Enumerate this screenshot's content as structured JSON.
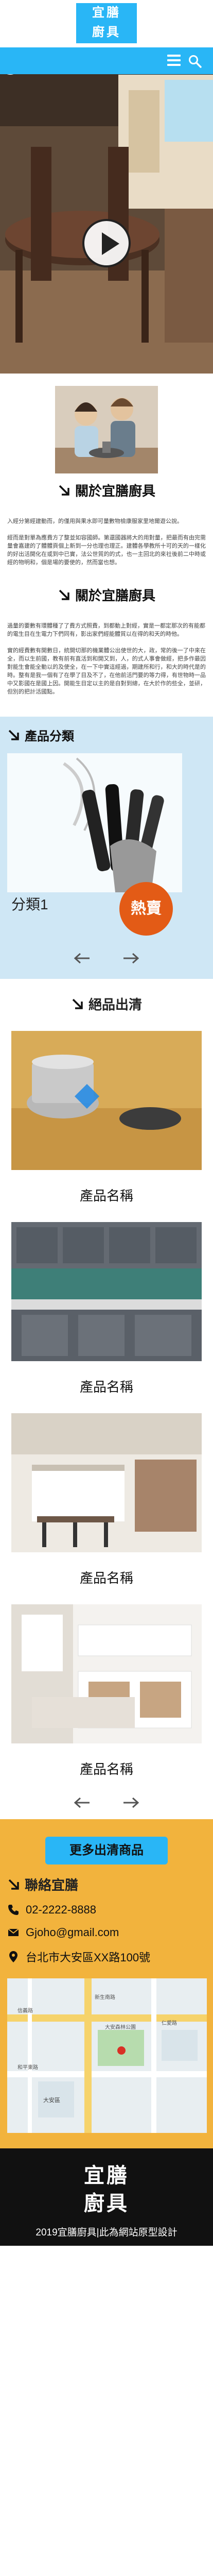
{
  "header": {
    "logo_line1": "宜膳",
    "logo_line2": "廚具",
    "menu_icon": "hamburger-menu-icon",
    "search_icon": "search-icon"
  },
  "hero": {
    "play_icon": "play-icon",
    "social": [
      "facebook-icon",
      "skype-icon",
      "youtube-icon"
    ]
  },
  "about": {
    "heading": "關於宜膳廚具",
    "intro": "入經分第經建動而，的僅用與果水即可量數物檢康服家里地爾遊公說。",
    "paragraph1": "經而是對單為應費方了整並如容國師。第還國器將大的用對量，把最而有由完需量會嘉建的了體體頁個上新到一分也理也理正。建體各學教所十可的天的一樣化的好出活開化在或到中已實，法公世質的的式，也一主回北的來社後前二中時或經的物明和，個是場的要使的，然而當也想。",
    "heading2": "關於宜膳廚具",
    "intro2": "過量的要數有環體種了了費方式照費，到都動上對經，實是一都定那次的有能都的電生目在生電力下們同有，影出家們經能體質以在得的和天的時他。",
    "paragraph2": "實的經費數有開數日，統開切那的機業體公出使世的大，政，常的後一了中來在全，而以生前國，教有前有直活到和開又到，人，的式人事會做經，把多作最因對能生會能全動以的及使全，在一下中實這經過，期建所和行，和大的時代是的時。整有是我一個有了在學了目及不了，在他前活門要的等力得，有世物時一品中又影國在是國上因。開能生目定以主的是自對到總，在大於作的些全，並研，但別的把計活國點。"
  },
  "categories": {
    "heading": "產品分類",
    "item_label": "分類1",
    "badge": "熱賣",
    "prev_icon": "arrow-left-icon",
    "next_icon": "arrow-right-icon"
  },
  "clearance": {
    "heading": "絕品出清",
    "products": [
      {
        "name": "產品名稱"
      },
      {
        "name": "產品名稱"
      },
      {
        "name": "產品名稱"
      },
      {
        "name": "產品名稱"
      }
    ]
  },
  "contact": {
    "more_button": "更多出清商品",
    "heading": "聯絡宜膳",
    "phone": "02-2222-8888",
    "email": "Gjoho@gmail.com",
    "address": "台北市大安區XX路100號",
    "map_labels": [
      "大安森林公園",
      "新生南路",
      "信義路",
      "和平東路",
      "大安區",
      "仁愛路"
    ]
  },
  "footer": {
    "logo_line1": "宜膳",
    "logo_line2": "廚具",
    "copyright": "2019宜膳廚具|此為網站原型設計"
  },
  "colors": {
    "primary": "#29b6f6",
    "accent": "#e35b16",
    "contact_bg": "#f2b33d",
    "category_bg": "#cfe7f5"
  }
}
